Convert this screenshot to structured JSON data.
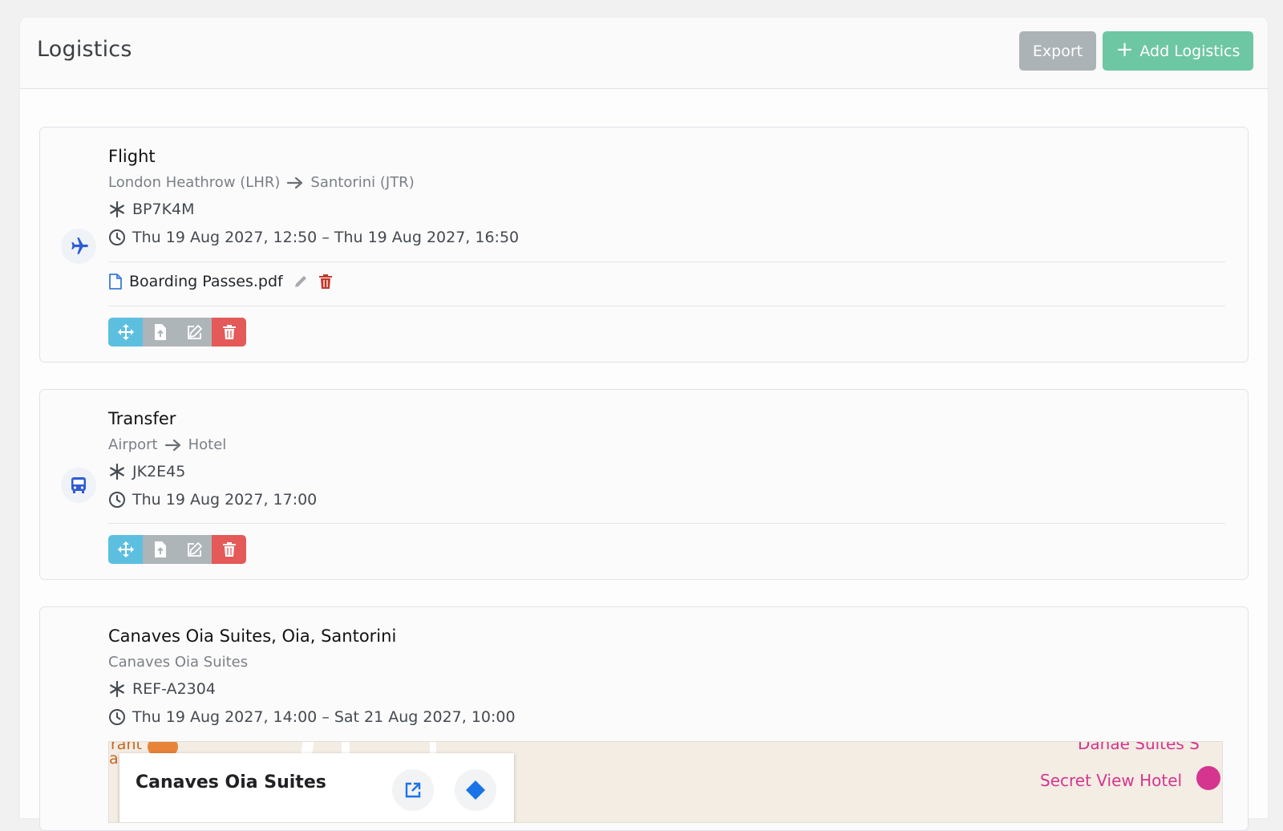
{
  "header": {
    "title": "Logistics",
    "export_label": "Export",
    "add_label": "Add Logistics"
  },
  "cards": [
    {
      "type_icon": "plane-icon",
      "title": "Flight",
      "from": "London Heathrow (LHR)",
      "to": "Santorini (JTR)",
      "reference": "BP7K4M",
      "datetime": "Thu 19 Aug 2027, 12:50 – Thu 19 Aug 2027, 16:50",
      "files": [
        {
          "name": "Boarding Passes.pdf"
        }
      ]
    },
    {
      "type_icon": "bus-icon",
      "title": "Transfer",
      "from": "Airport",
      "to": "Hotel",
      "reference": "JK2E45",
      "datetime": "Thu 19 Aug 2027, 17:00"
    },
    {
      "type_icon": "hotel-icon",
      "title": "Canaves Oia Suites, Oia, Santorini",
      "subtitle": "Canaves Oia Suites",
      "reference": "REF-A2304",
      "datetime": "Thu 19 Aug 2027, 14:00 – Sat 21 Aug 2027, 10:00",
      "map": {
        "place_name": "Canaves Oia Suites",
        "poi_1": "Danae Suites S",
        "poi_2": "Secret View Hotel",
        "restaurant_fragment_1": "rant",
        "restaurant_fragment_2": "a"
      }
    }
  ],
  "colors": {
    "accent_blue": "#2f5bd3",
    "move": "#5dbfe0",
    "neutral": "#aeb5b9",
    "danger": "#e35a58",
    "success": "#6ec7a3"
  }
}
